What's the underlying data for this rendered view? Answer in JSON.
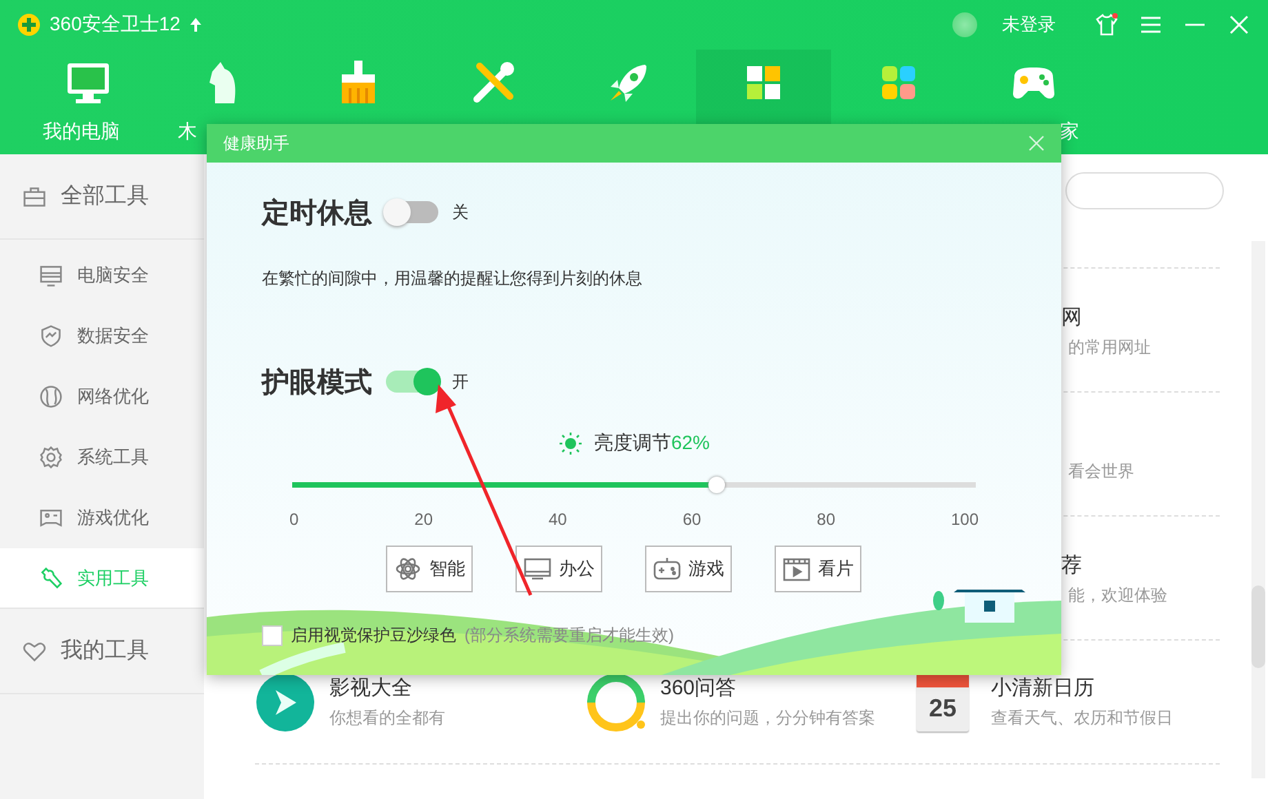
{
  "app": {
    "title": "360安全卫士12",
    "user": "未登录"
  },
  "nav_tabs": [
    {
      "kind": "monitor",
      "label": "我的电脑",
      "selected": false
    },
    {
      "kind": "horse",
      "label": "木",
      "selected": false
    },
    {
      "kind": "broom",
      "selected": false
    },
    {
      "kind": "tools",
      "selected": false
    },
    {
      "kind": "rocket",
      "selected": false
    },
    {
      "kind": "grid",
      "selected": true
    },
    {
      "kind": "tiles",
      "selected": false
    },
    {
      "kind": "gamepad",
      "label": "家",
      "selected": false
    }
  ],
  "sidebar": [
    {
      "kind": "group",
      "label": "全部工具",
      "selected": false
    },
    {
      "kind": "item",
      "label": "电脑安全",
      "selected": false
    },
    {
      "kind": "item",
      "label": "数据安全",
      "selected": false
    },
    {
      "kind": "item",
      "label": "网络优化",
      "selected": false
    },
    {
      "kind": "item",
      "label": "系统工具",
      "selected": false
    },
    {
      "kind": "item",
      "label": "游戏优化",
      "selected": false
    },
    {
      "kind": "item",
      "label": "实用工具",
      "selected": true
    },
    {
      "kind": "group",
      "label": "我的工具",
      "selected": false
    }
  ],
  "tool_rows": [
    {
      "kind": "partial",
      "title": "网",
      "subtitle": "的常用网址"
    },
    {
      "kind": "partial",
      "subtitle": "看会世界"
    },
    {
      "kind": "partial",
      "title": "荐",
      "subtitle": "能，欢迎体验"
    },
    {
      "kind": "full",
      "items": [
        {
          "title": "影视大全",
          "subtitle": "你想看的全都有"
        },
        {
          "title": "360问答",
          "subtitle": "提出你的问题，分分钟有答案"
        },
        {
          "icon_text": "25",
          "title": "小清新日历",
          "subtitle": "查看天气、农历和节假日"
        }
      ]
    }
  ],
  "dialog": {
    "title": "健康助手",
    "timed_rest": {
      "label": "定时休息",
      "on": false,
      "state_label": "关"
    },
    "description": "在繁忙的间隙中，用温馨的提醒让您得到片刻的休息",
    "eye_mode": {
      "label": "护眼模式",
      "on": true,
      "state_label": "开"
    },
    "brightness": {
      "label": "亮度调节",
      "value_text": "62%",
      "level": 0.62
    },
    "ticks": [
      "0",
      "20",
      "40",
      "60",
      "80",
      "100"
    ],
    "modes": [
      {
        "kind": "smart",
        "label": "智能"
      },
      {
        "kind": "office",
        "label": "办公"
      },
      {
        "kind": "game",
        "label": "游戏"
      },
      {
        "kind": "movie",
        "label": "看片"
      }
    ],
    "bean_green": {
      "label": "启用视觉保护豆沙绿色",
      "note": "(部分系统需要重启才能生效)",
      "checked": false
    }
  }
}
